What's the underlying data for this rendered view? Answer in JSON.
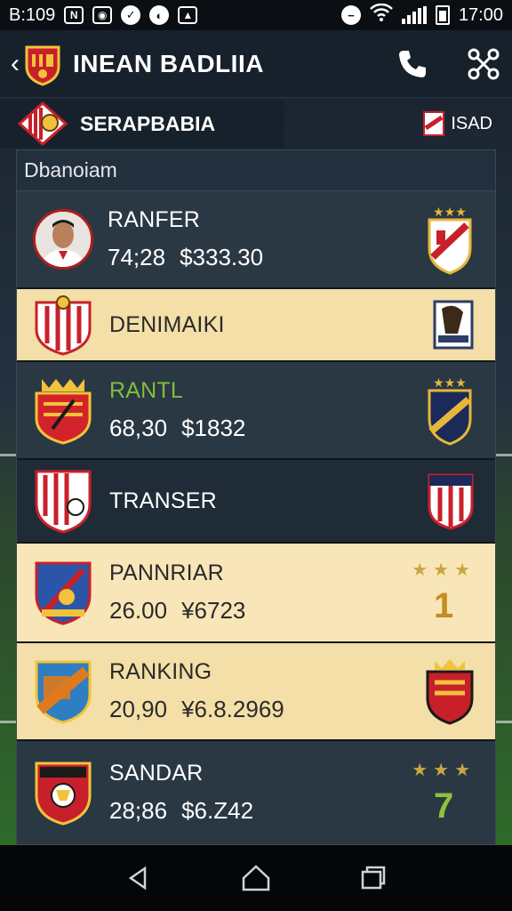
{
  "status_bar": {
    "left_text": "B:109",
    "time": "17:00"
  },
  "header": {
    "title": "INEAN BADLIIA",
    "back_icon": "back-arrow-icon",
    "call_icon": "phone-icon",
    "share_icon": "share-icon"
  },
  "sub_header": {
    "title": "SERAPBABIA",
    "right_label": "ISAD"
  },
  "panel": {
    "heading": "Dbanoiam"
  },
  "rows": [
    {
      "name": "RANFER",
      "stat1": "74;28",
      "stat2": "$333.30"
    },
    {
      "name": "DENIMAIKI"
    },
    {
      "name": "RANTL",
      "stat1": "68,30",
      "stat2": "$1832"
    },
    {
      "name": "TRANSER"
    },
    {
      "name": "PANNRIAR",
      "stat1": "26.00",
      "stat2": "¥6723",
      "rank": "1",
      "stars": "★★★"
    },
    {
      "name": "RANKING",
      "stat1": "20,90",
      "stat2": "¥6.8.2969"
    },
    {
      "name": "SANDAR",
      "stat1": "28;86",
      "stat2": "$6.Z42",
      "rank": "7",
      "stars": "★★★"
    }
  ],
  "colors": {
    "accent_red": "#c8202a",
    "gold": "#c9a640",
    "cream_row": "#f3dfa7"
  }
}
